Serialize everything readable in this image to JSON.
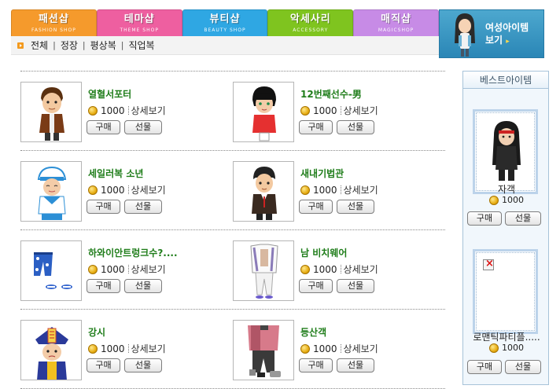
{
  "tabs": [
    {
      "label": "패션샵",
      "sub": "FASHION SHOP",
      "color": "#f59a2c"
    },
    {
      "label": "테마샵",
      "sub": "THEME SHOP",
      "color": "#ee5fa0"
    },
    {
      "label": "뷰티샵",
      "sub": "BEAUTY SHOP",
      "color": "#2fa7e3"
    },
    {
      "label": "악세사리",
      "sub": "ACCESSORY",
      "color": "#7fc41f"
    },
    {
      "label": "매직샵",
      "sub": "MAGICSHOP",
      "color": "#c78be6"
    }
  ],
  "promo": {
    "line1": "여성아이템",
    "line2": "보기",
    "arrow": "▸"
  },
  "submenu": [
    "전체",
    "정장",
    "평상복",
    "직업복"
  ],
  "labels": {
    "detail": "상세보기",
    "buy": "구매",
    "gift": "선물"
  },
  "products": [
    {
      "name": "열혈서포터",
      "price": "1000",
      "icon": "boy-avatar"
    },
    {
      "name": "12번째선수-男",
      "price": "1000",
      "icon": "soccer-avatar"
    },
    {
      "name": "세일러복 소년",
      "price": "1000",
      "icon": "sailor-avatar"
    },
    {
      "name": "새내기법관",
      "price": "1000",
      "icon": "suit-avatar"
    },
    {
      "name": "하와이안트렁크수?....",
      "price": "1000",
      "icon": "trunks-item"
    },
    {
      "name": "남 비치웨어",
      "price": "1000",
      "icon": "beachwear-item"
    },
    {
      "name": "강시",
      "price": "1000",
      "icon": "jiangshi-avatar"
    },
    {
      "name": "등산객",
      "price": "1000",
      "icon": "hiker-item"
    }
  ],
  "sidebar": {
    "title": "베스트아이템",
    "items": [
      {
        "name": "자객",
        "price": "1000",
        "icon": "assassin-avatar"
      },
      {
        "name": "로맨틱파티플.....",
        "price": "1000",
        "icon": "broken-image-icon"
      }
    ]
  }
}
